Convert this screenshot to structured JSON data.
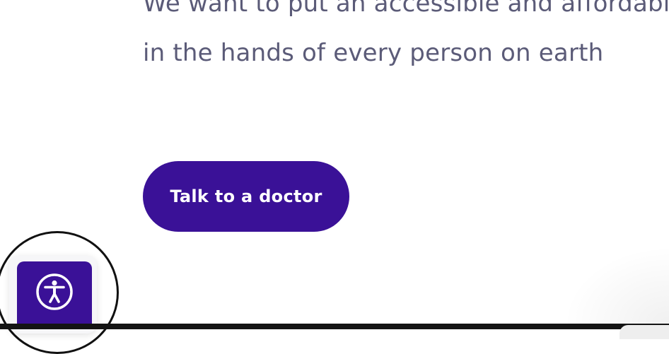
{
  "hero": {
    "line1": "We want to put an accessible and affordable",
    "line2": "in the hands of every person on earth"
  },
  "cta": {
    "label": "Talk to a doctor"
  },
  "accessibility_widget": {
    "icon": "accessibility-icon",
    "accent_color": "#3a1197"
  },
  "colors": {
    "text": "#5b5b78",
    "brand": "#3a1197",
    "background": "#ffffff"
  }
}
